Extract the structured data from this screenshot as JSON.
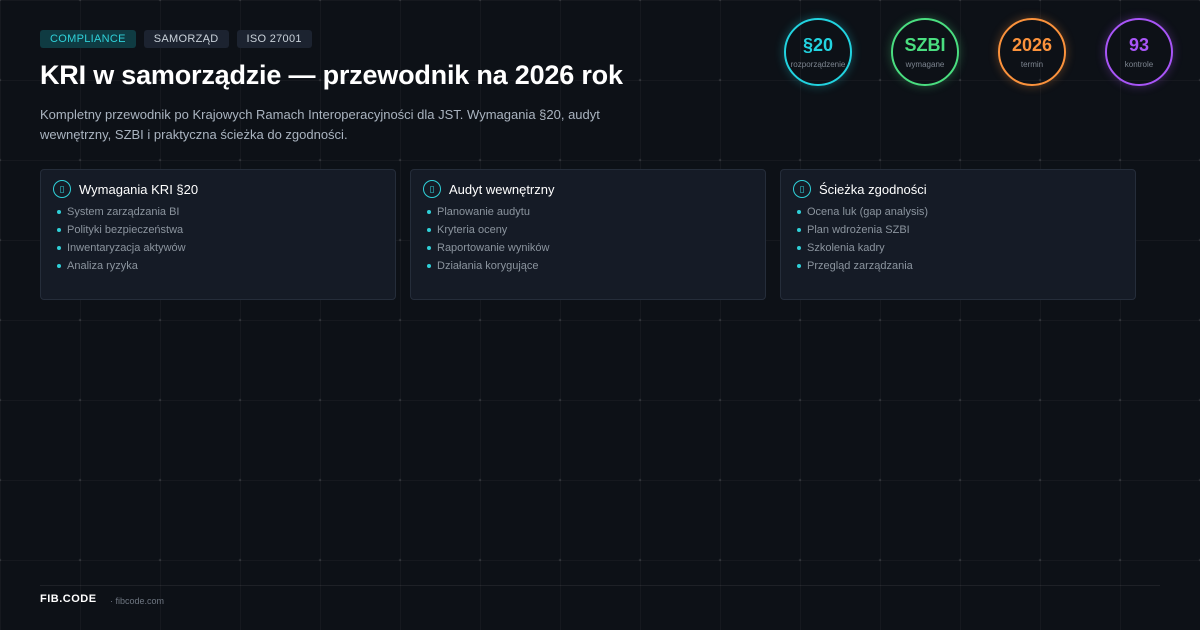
{
  "tags": [
    "COMPLIANCE",
    "SAMORZĄD",
    "ISO 27001"
  ],
  "title": "KRI w samorządzie — przewodnik na 2026 rok",
  "description": "Kompletny przewodnik po Krajowych Ramach Interoperacyjności dla JST. Wymagania §20, audyt wewnętrzny, SZBI i praktyczna ścieżka do zgodności.",
  "stats": [
    {
      "value": "§20",
      "label": "rozporządzenie",
      "color": "#22d3e0"
    },
    {
      "value": "SZBI",
      "label": "wymagane",
      "color": "#4ade80"
    },
    {
      "value": "2026",
      "label": "termin",
      "color": "#fb923c"
    },
    {
      "value": "93",
      "label": "kontrole",
      "color": "#a855f7"
    }
  ],
  "cards": [
    {
      "icon": "document-icon",
      "glyph": "▯",
      "title": "Wymagania KRI §20",
      "items": [
        "System zarządzania BI",
        "Polityki bezpieczeństwa",
        "Inwentaryzacja aktywów",
        "Analiza ryzyka"
      ]
    },
    {
      "icon": "document-icon",
      "glyph": "▯",
      "title": "Audyt wewnętrzny",
      "items": [
        "Planowanie audytu",
        "Kryteria oceny",
        "Raportowanie wyników",
        "Działania korygujące"
      ]
    },
    {
      "icon": "document-icon",
      "glyph": "▯",
      "title": "Ścieżka zgodności",
      "items": [
        "Ocena luk (gap analysis)",
        "Plan wdrożenia SZBI",
        "Szkolenia kadry",
        "Przegląd zarządzania"
      ]
    }
  ],
  "footer": {
    "brand": "FIB.CODE",
    "domain": "· fibcode.com"
  }
}
